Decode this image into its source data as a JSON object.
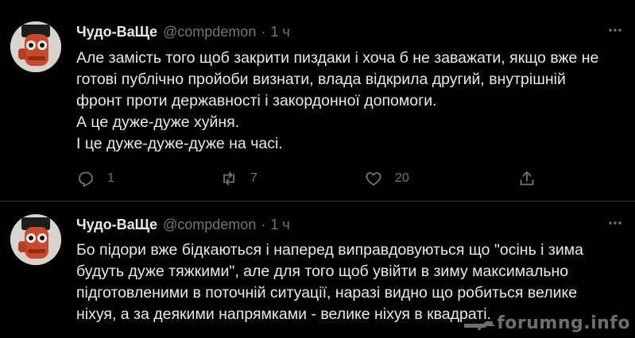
{
  "tweets": [
    {
      "author_name": "Чудо-ВаЩе",
      "handle": "@compdemon",
      "separator": "·",
      "time": "1 ч",
      "more_icon": "more-dots-icon",
      "lines": [
        "Але замість того щоб закрити пиздаки і хоча б не заважати, якщо вже не",
        "готові публічно пройоби визнати, влада відкрила другий, внутрішній",
        "фронт проти державності і закордонної допомоги.",
        "А це дуже-дуже хуйня.",
        "І це дуже-дуже-дуже на часі."
      ],
      "actions": {
        "reply_count": "1",
        "retweet_count": "7",
        "like_count": "20"
      }
    },
    {
      "author_name": "Чудо-ВаЩе",
      "handle": "@compdemon",
      "separator": "·",
      "time": "1 ч",
      "more_icon": "more-dots-icon",
      "lines": [
        "Бо підори вже бідкаються і наперед виправдовуються що \"осінь і зима",
        "будуть дуже тяжкими\", але для того щоб увійти в зиму максимально",
        "підготовленими в поточній ситуації, наразі видно що робиться велике",
        "ніхуя, а за деякими напрямками - велике ніхуя в квадраті."
      ]
    }
  ],
  "watermark": "forumng.info",
  "colors": {
    "background": "#000000",
    "text": "#e7e9ea",
    "muted": "#71767b",
    "divider": "#2f3336"
  }
}
